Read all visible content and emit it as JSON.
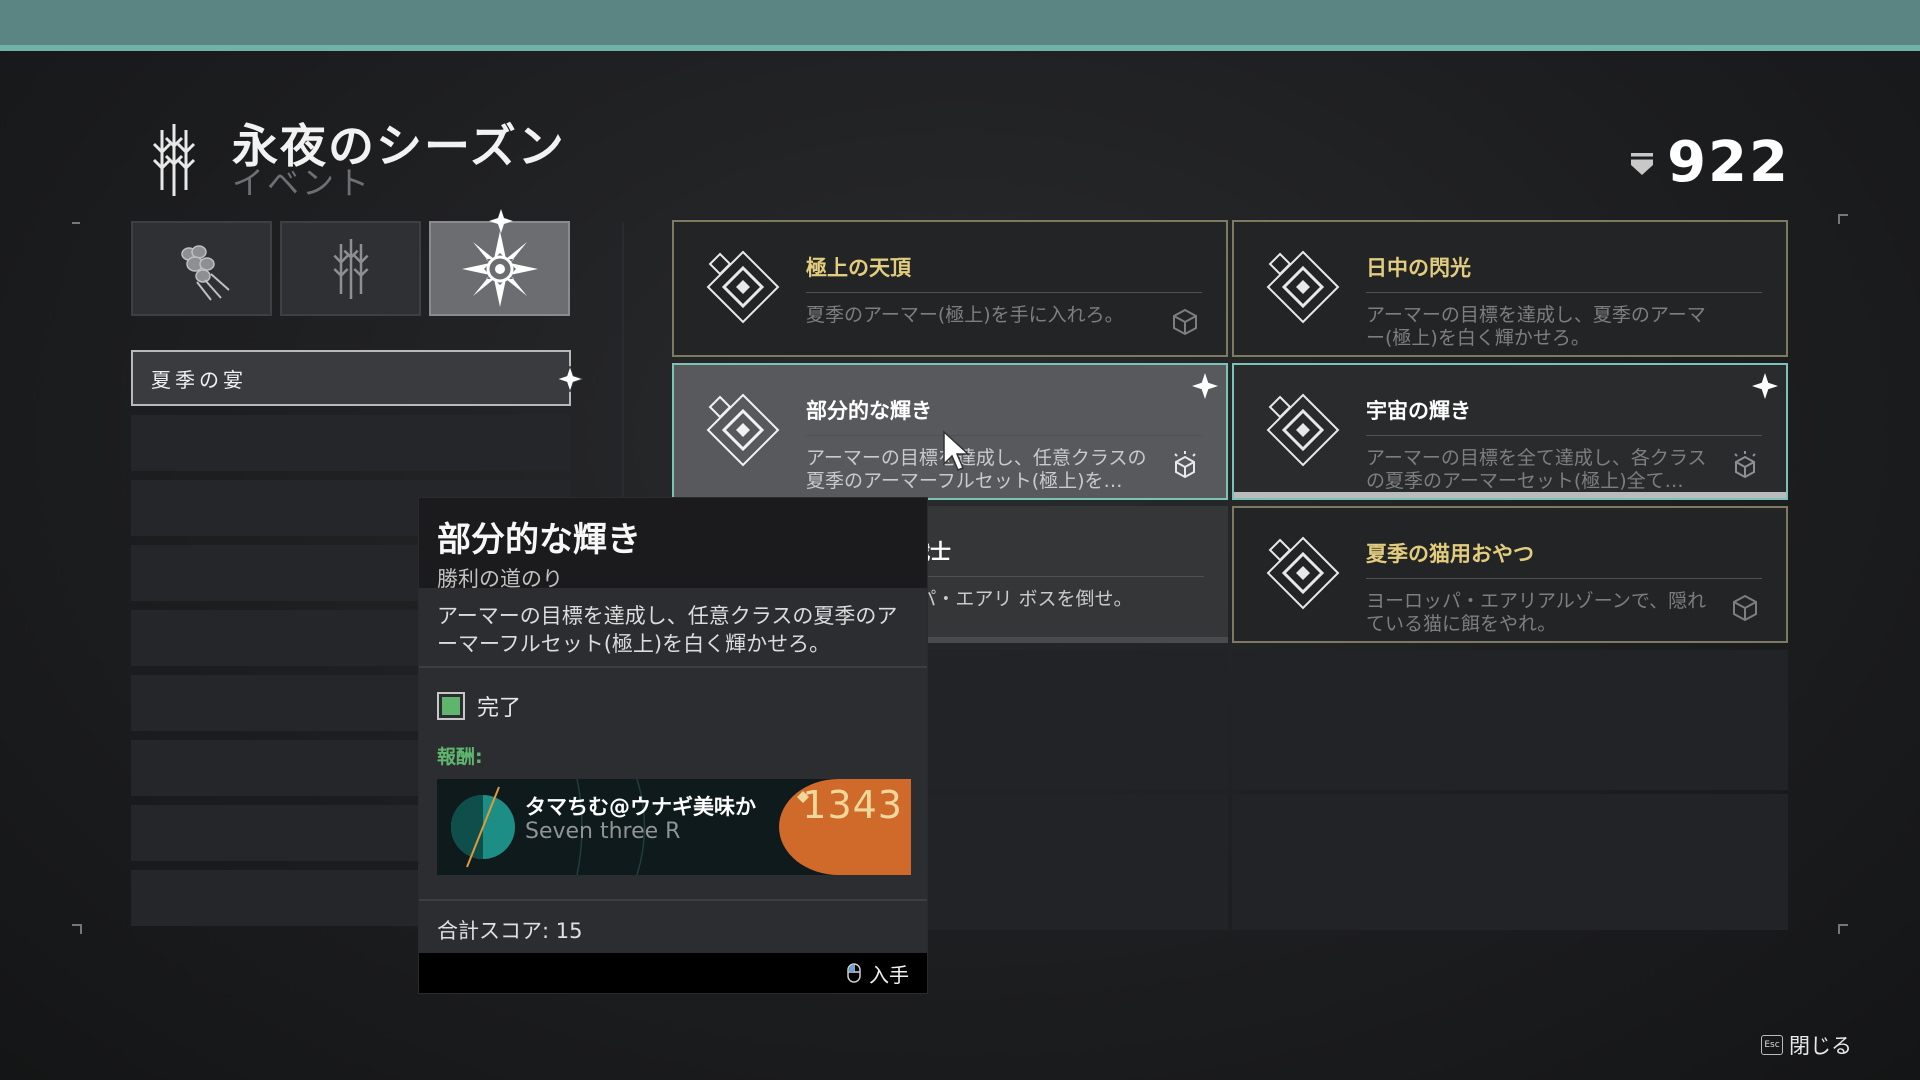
{
  "header": {
    "title": "永夜のシーズン",
    "subtitle": "イベント",
    "currency_value": "922"
  },
  "tabs": [
    {
      "icon": "claw-emblem-icon",
      "active": false
    },
    {
      "icon": "season-glyph-icon",
      "active": false
    },
    {
      "icon": "solstice-star-icon",
      "active": true
    }
  ],
  "sidebar": {
    "selected_label": "夏季の宴"
  },
  "cards": [
    {
      "title": "極上の天頂",
      "desc": "夏季のアーマー(極上)を手に入れろ。",
      "state": "gold"
    },
    {
      "title": "日中の閃光",
      "desc": "アーマーの目標を達成し、夏季のアーマー(極上)を白く輝かせろ。",
      "state": "gold"
    },
    {
      "title": "部分的な輝き",
      "desc": "アーマーの目標を達成し、任意クラスの夏季のアーマーフルセット(極上)を…",
      "state": "complete"
    },
    {
      "title": "宇宙の輝き",
      "desc": "アーマーの目標を全て達成し、各クラスの夏季のアーマーセット(極上)全て…",
      "state": "complete"
    },
    {
      "title": "手に負えぬ戦士",
      "desc": "に、ヨーロッパ・エアリ ボスを倒せ。",
      "state": "partial"
    },
    {
      "title": "夏季の猫用おやつ",
      "desc": "ヨーロッパ・エアリアルゾーンで、隠れている猫に餌をやれ。",
      "state": "gold"
    }
  ],
  "tooltip": {
    "title": "部分的な輝き",
    "subtitle": "勝利の道のり",
    "description": "アーマーの目標を達成し、任意クラスの夏季のアーマーフルセット(極上)を白く輝かせろ。",
    "objective_label": "完了",
    "reward_label": "報酬:",
    "reward_name": "タマちむ@ウナギ美味か",
    "reward_sub": "Seven three R",
    "reward_score": "1343",
    "total_score": "合計スコア: 15",
    "action_label": "入手"
  },
  "footer": {
    "close_label": "閉じる",
    "esc_key": "Esc"
  },
  "colors": {
    "accent_teal": "#6fb3a8",
    "gold_title": "#e2cc7e",
    "complete_green": "#5fb56e",
    "score_orange": "#d06a2a"
  }
}
